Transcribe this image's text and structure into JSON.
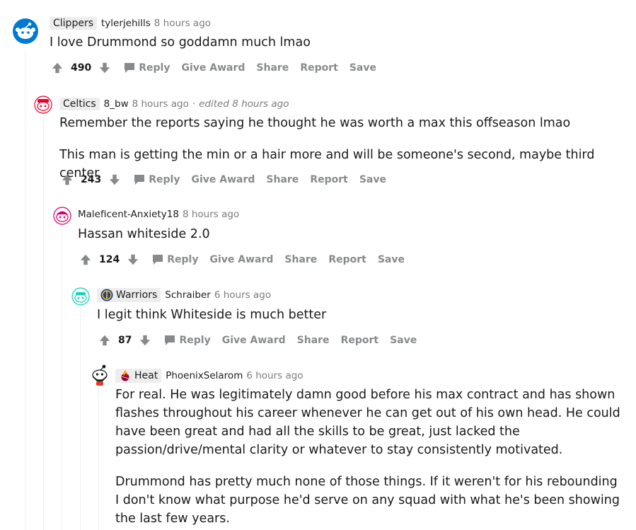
{
  "comments": [
    {
      "flair": "Clippers",
      "author": "tylerjehills",
      "time": "8 hours ago",
      "edited": "",
      "paragraphs": [
        "I love Drummond so goddamn much lmao"
      ],
      "score": "490"
    },
    {
      "flair": "Celtics",
      "author": "8_bw",
      "time": "8 hours ago",
      "edited": "edited 8 hours ago",
      "paragraphs": [
        "Remember the reports saying he thought he was worth a max this offseason lmao",
        "This man is getting the min or a hair more and will be someone's second, maybe third center"
      ],
      "score": "243"
    },
    {
      "flair": "",
      "author": "Maleficent-Anxiety18",
      "time": "8 hours ago",
      "edited": "",
      "paragraphs": [
        "Hassan whiteside 2.0"
      ],
      "score": "124"
    },
    {
      "flair": "Warriors",
      "author": "Schraiber",
      "time": "6 hours ago",
      "edited": "",
      "paragraphs": [
        "I legit think Whiteside is much better"
      ],
      "score": "87"
    },
    {
      "flair": "Heat",
      "author": "PhoenixSelarom",
      "time": "6 hours ago",
      "edited": "",
      "paragraphs": [
        "For real. He was legitimately damn good before his max contract and has shown flashes throughout his career whenever he can get out of his own head. He could have been great and had all the skills to be great, just lacked the passion/drive/mental clarity or whatever to stay consistently motivated.",
        "Drummond has pretty much none of those things. If it weren't for his rebounding I don't know what purpose he'd serve on any squad with what he's been showing the last few years."
      ],
      "score": ""
    }
  ],
  "actions": {
    "reply": "Reply",
    "give_award": "Give Award",
    "share": "Share",
    "report": "Report",
    "save": "Save"
  },
  "icons": {
    "upvote": "upvote-arrow-icon",
    "downvote": "downvote-arrow-icon",
    "reply": "speech-bubble-icon",
    "warriors_flair": "warriors-logo-icon",
    "heat_flair": "heat-logo-icon"
  },
  "colors": {
    "arrow": "#878a8c",
    "meta": "#7c7c7c",
    "flair_bg": "#ededed",
    "thread_line": "#edeff1"
  }
}
